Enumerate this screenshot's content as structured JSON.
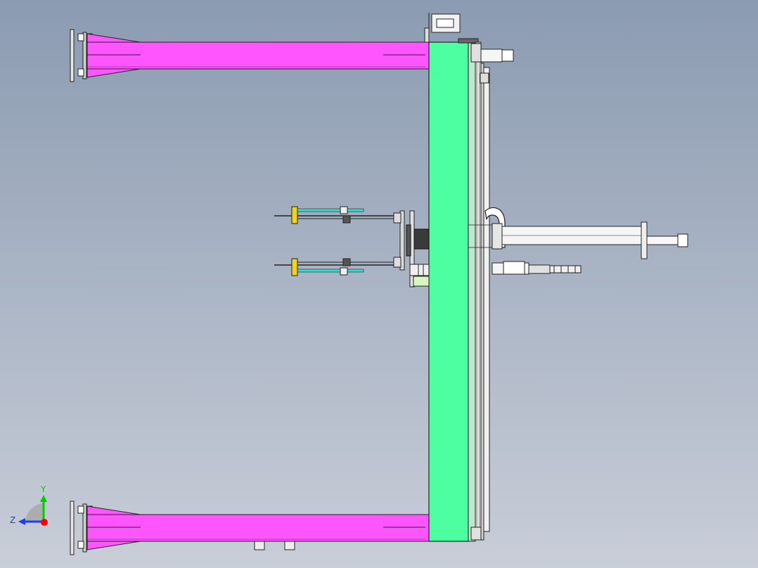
{
  "viewport": {
    "background_top": "#8b9bb1",
    "background_bottom": "#c9ced8"
  },
  "colors": {
    "beam": "#ff55ff",
    "column": "#4dffa0",
    "accent_yellow": "#f2d21a",
    "accent_cyan": "#3fd6cc",
    "metal": "#d8d8d8",
    "outline": "#1a1a1a",
    "axis_x": "#ff0000",
    "axis_y": "#00cc00",
    "axis_z": "#1a3cff"
  },
  "triad": {
    "y_label": "Y",
    "z_label": "Z",
    "icon": "coordinate-triad-icon"
  }
}
